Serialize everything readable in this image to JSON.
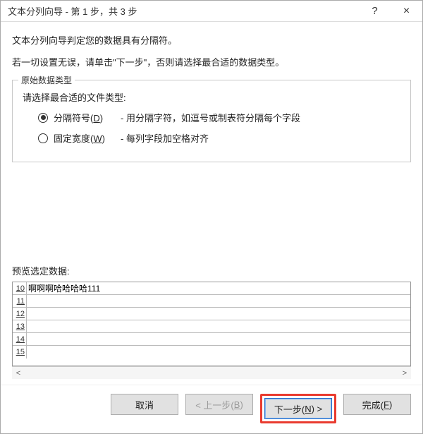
{
  "titlebar": {
    "title": "文本分列向导 - 第 1 步，共 3 步",
    "help": "?",
    "close": "×"
  },
  "intro": "文本分列向导判定您的数据具有分隔符。",
  "instruction": "若一切设置无误，请单击\"下一步\"，否则请选择最合适的数据类型。",
  "fieldset": {
    "legend": "原始数据类型",
    "prompt": "请选择最合适的文件类型:",
    "options": [
      {
        "selected": true,
        "label_html": "分隔符号(<span class=\"ul\">D</span>)",
        "desc": "- 用分隔字符，如逗号或制表符分隔每个字段"
      },
      {
        "selected": false,
        "label_html": "固定宽度(<span class=\"ul\">W</span>)",
        "desc": "- 每列字段加空格对齐"
      }
    ]
  },
  "preview": {
    "label": "预览选定数据:",
    "rows": [
      {
        "num": "10",
        "data": "啊啊啊哈哈哈哈111"
      },
      {
        "num": "11",
        "data": ""
      },
      {
        "num": "12",
        "data": ""
      },
      {
        "num": "13",
        "data": ""
      },
      {
        "num": "14",
        "data": ""
      },
      {
        "num": "15",
        "data": ""
      }
    ]
  },
  "buttons": {
    "cancel": "取消",
    "back_html": "< 上一步(<span class=\"ul\">B</span>)",
    "next_html": "下一步(<span class=\"ul\">N</span>) >",
    "finish_html": "完成(<span class=\"ul\">F</span>)"
  }
}
